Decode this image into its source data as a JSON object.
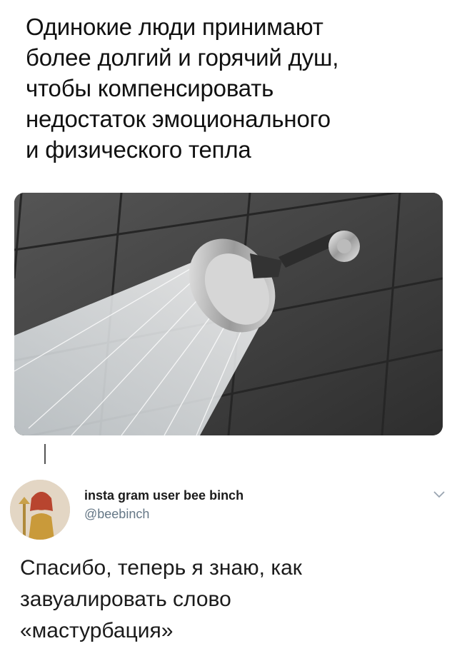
{
  "headline": {
    "lines": [
      "Одинокие люди принимают",
      "более долгий и горячий душ,",
      "чтобы компенсировать",
      "недостаток эмоционального",
      "и физического тепла"
    ]
  },
  "photo": {
    "alt_icon": "shower-head-icon"
  },
  "reply": {
    "display_name": "insta gram user bee binch",
    "handle": "@beebinch",
    "text_lines": [
      "Спасибо, теперь я знаю, как",
      "завуалировать слово",
      "«мастурбация»"
    ]
  },
  "colors": {
    "text": "#111111",
    "handle": "#657786",
    "tile": "#3f3f3f",
    "grout": "#2a2a2a"
  }
}
